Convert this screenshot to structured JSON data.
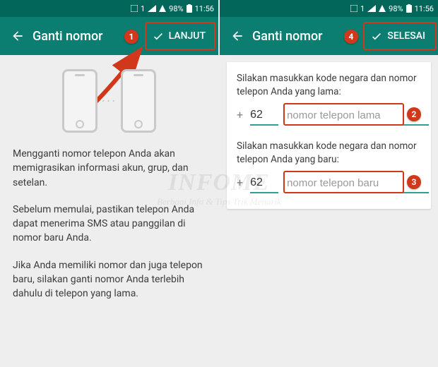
{
  "statusbar": {
    "sim_label": "1",
    "battery_pct": "98%",
    "time": "11:56"
  },
  "appbar": {
    "title": "Ganti nomor",
    "action_left": "LANJUT",
    "action_right": "SELESAI"
  },
  "steps": {
    "s1": "1",
    "s2": "2",
    "s3": "3",
    "s4": "4"
  },
  "screen1": {
    "p1": "Mengganti nomor telepon Anda akan memigrasikan informasi akun, grup, dan setelan.",
    "p2": "Sebelum memulai, pastikan telepon Anda dapat menerima SMS atau panggilan di nomor baru Anda.",
    "p3": "Jika Anda memiliki nomor dan juga telepon baru, silakan ganti nomor Anda terlebih dahulu di telepon yang lama."
  },
  "screen2": {
    "prompt_old": "Silakan masukkan kode negara dan nomor telepon Anda yang lama:",
    "prompt_new": "Silakan masukkan kode negara dan nomor telepon Anda yang baru:",
    "country_code": "62",
    "placeholder_old": "nomor telepon lama",
    "placeholder_new": "nomor telepon baru"
  },
  "watermark": {
    "big": "INFOME",
    "small": "Berbagi Info & Tips Trik Menarik"
  }
}
